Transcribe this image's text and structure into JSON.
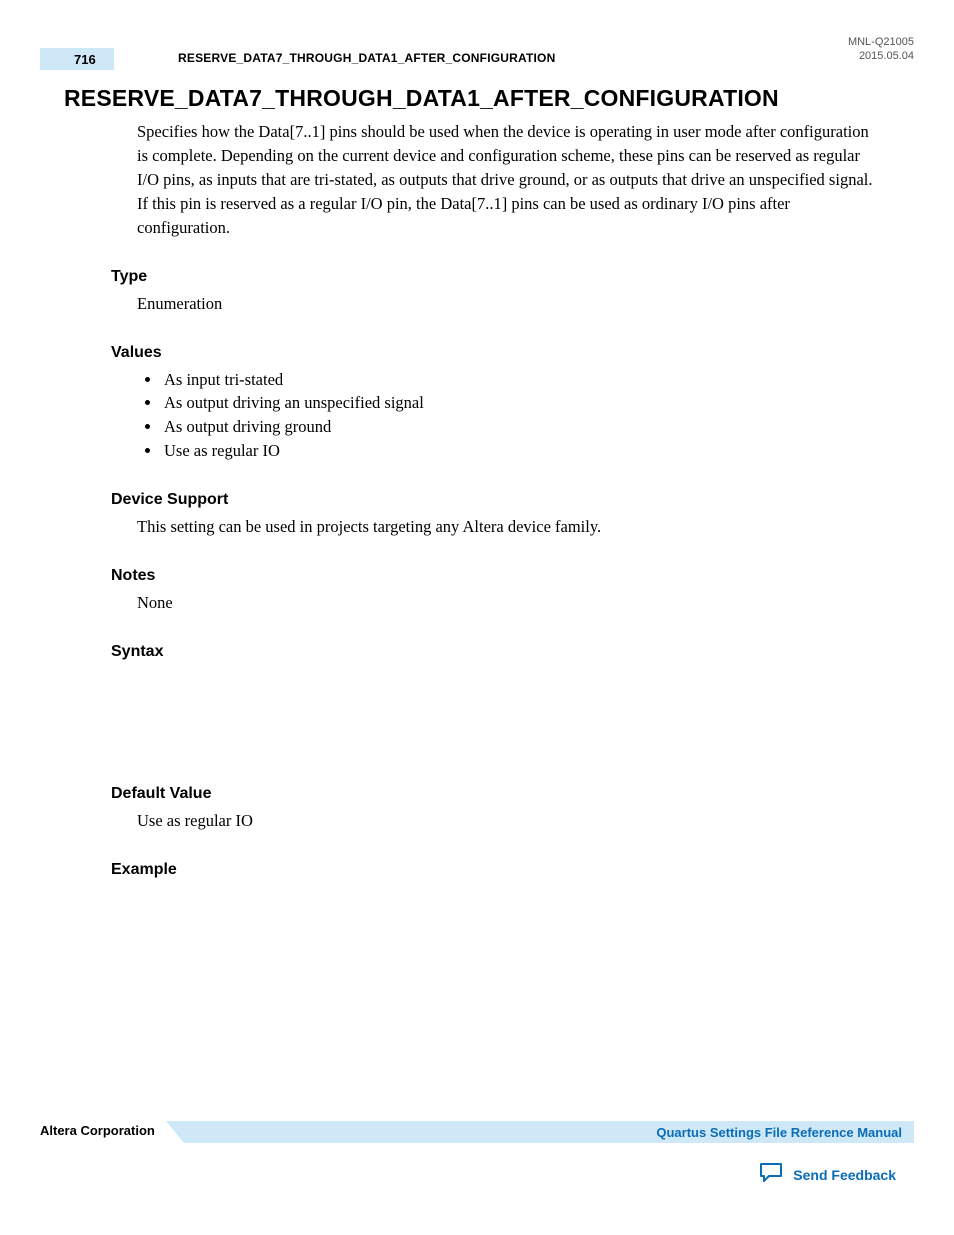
{
  "header": {
    "page_number": "716",
    "running_title": "RESERVE_DATA7_THROUGH_DATA1_AFTER_CONFIGURATION",
    "doc_id": "MNL-Q21005",
    "date": "2015.05.04"
  },
  "title": "RESERVE_DATA7_THROUGH_DATA1_AFTER_CONFIGURATION",
  "description": "Specifies how the Data[7..1] pins should be used when the device is operating in user mode after configuration is complete. Depending on the current device and configuration scheme, these pins can be reserved as regular I/O pins, as inputs that are tri-stated, as outputs that drive ground, or as outputs that drive an unspecified signal. If this pin is reserved as a regular I/O pin, the Data[7..1] pins can be used as ordinary I/O pins after configuration.",
  "sections": {
    "type_label": "Type",
    "type_body": "Enumeration",
    "values_label": "Values",
    "values": [
      "As input tri-stated",
      "As output driving an unspecified signal",
      "As output driving ground",
      "Use as regular IO"
    ],
    "device_support_label": "Device Support",
    "device_support_body": "This setting can be used in projects targeting any Altera device family.",
    "notes_label": "Notes",
    "notes_body": "None",
    "syntax_label": "Syntax",
    "default_value_label": "Default Value",
    "default_value_body": "Use as regular IO",
    "example_label": "Example"
  },
  "footer": {
    "company": "Altera Corporation",
    "manual": "Quartus Settings File Reference Manual",
    "feedback": "Send Feedback"
  }
}
